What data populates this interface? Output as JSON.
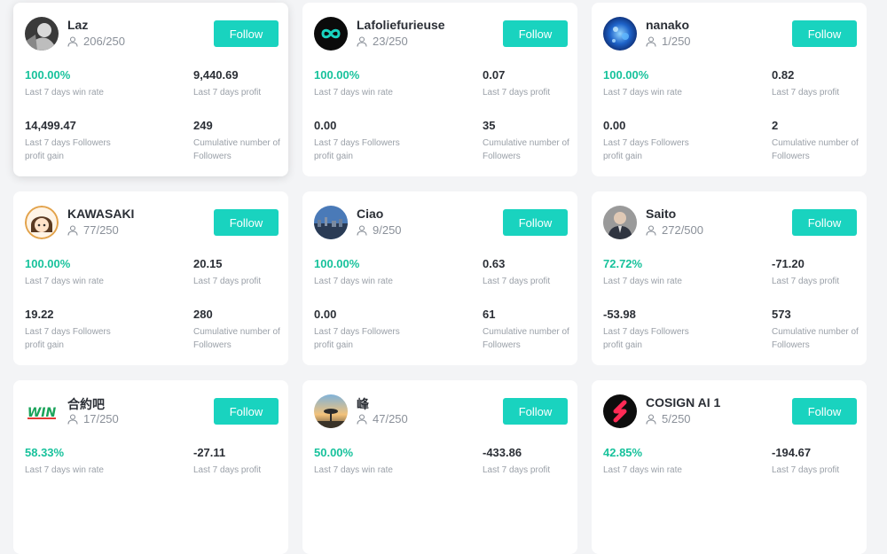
{
  "follow_label": "Follow",
  "colors": {
    "accent": "#19d3bf",
    "positive": "#18c29c"
  },
  "cards": [
    {
      "name": "Laz",
      "followers": "206/250",
      "avatar_icon": "portrait-bw-avatar-icon",
      "win_rate": "100.00%",
      "win_rate_label": "Last 7 days win rate",
      "profit": "9,440.69",
      "profit_label": "Last 7 days profit",
      "followers_gain": "14,499.47",
      "followers_gain_label": "Last 7 days Followers profit gain",
      "cumulative": "249",
      "cumulative_label": "Cumulative number of Followers"
    },
    {
      "name": "Lafoliefurieuse",
      "followers": "23/250",
      "avatar_icon": "infinity-logo-avatar-icon",
      "win_rate": "100.00%",
      "win_rate_label": "Last 7 days win rate",
      "profit": "0.07",
      "profit_label": "Last 7 days profit",
      "followers_gain": "0.00",
      "followers_gain_label": "Last 7 days Followers profit gain",
      "cumulative": "35",
      "cumulative_label": "Cumulative number of Followers"
    },
    {
      "name": "nanako",
      "followers": "1/250",
      "avatar_icon": "blue-abstract-avatar-icon",
      "win_rate": "100.00%",
      "win_rate_label": "Last 7 days win rate",
      "profit": "0.82",
      "profit_label": "Last 7 days profit",
      "followers_gain": "0.00",
      "followers_gain_label": "Last 7 days Followers profit gain",
      "cumulative": "2",
      "cumulative_label": "Cumulative number of Followers"
    },
    {
      "name": "KAWASAKI",
      "followers": "77/250",
      "avatar_icon": "anime-girl-avatar-icon",
      "win_rate": "100.00%",
      "win_rate_label": "Last 7 days win rate",
      "profit": "20.15",
      "profit_label": "Last 7 days profit",
      "followers_gain": "19.22",
      "followers_gain_label": "Last 7 days Followers profit gain",
      "cumulative": "280",
      "cumulative_label": "Cumulative number of Followers"
    },
    {
      "name": "Ciao",
      "followers": "9/250",
      "avatar_icon": "city-skyline-avatar-icon",
      "win_rate": "100.00%",
      "win_rate_label": "Last 7 days win rate",
      "profit": "0.63",
      "profit_label": "Last 7 days profit",
      "followers_gain": "0.00",
      "followers_gain_label": "Last 7 days Followers profit gain",
      "cumulative": "61",
      "cumulative_label": "Cumulative number of Followers"
    },
    {
      "name": "Saito",
      "followers": "272/500",
      "avatar_icon": "man-in-suit-avatar-icon",
      "win_rate": "72.72%",
      "win_rate_label": "Last 7 days win rate",
      "profit": "-71.20",
      "profit_label": "Last 7 days profit",
      "followers_gain": "-53.98",
      "followers_gain_label": "Last 7 days Followers profit gain",
      "cumulative": "573",
      "cumulative_label": "Cumulative number of Followers"
    },
    {
      "name": "合約吧",
      "followers": "17/250",
      "avatar_icon": "win-logo-avatar-icon",
      "avatar_text": "WIN",
      "win_rate": "58.33%",
      "win_rate_label": "Last 7 days win rate",
      "profit": "-27.11",
      "profit_label": "Last 7 days profit",
      "followers_gain": "",
      "followers_gain_label": "",
      "cumulative": "",
      "cumulative_label": ""
    },
    {
      "name": "峰",
      "followers": "47/250",
      "avatar_icon": "sunset-tree-avatar-icon",
      "win_rate": "50.00%",
      "win_rate_label": "Last 7 days win rate",
      "profit": "-433.86",
      "profit_label": "Last 7 days profit",
      "followers_gain": "",
      "followers_gain_label": "",
      "cumulative": "",
      "cumulative_label": ""
    },
    {
      "name": "COSIGN AI 1",
      "followers": "5/250",
      "avatar_icon": "cosign-logo-avatar-icon",
      "win_rate": "42.85%",
      "win_rate_label": "Last 7 days win rate",
      "profit": "-194.67",
      "profit_label": "Last 7 days profit",
      "followers_gain": "",
      "followers_gain_label": "",
      "cumulative": "",
      "cumulative_label": ""
    }
  ]
}
